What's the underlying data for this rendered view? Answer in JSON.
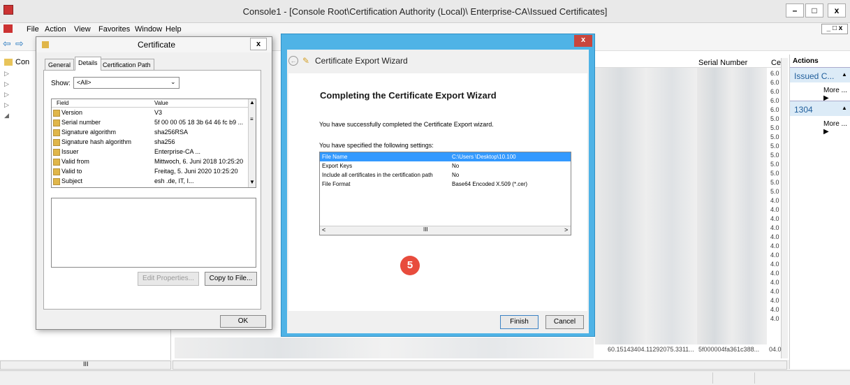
{
  "console": {
    "title": "Console1 - [Console Root\\Certification Authority (Local)\\           Enterprise-CA\\Issued Certificates]",
    "menu": [
      "File",
      "Action",
      "View",
      "Favorites",
      "Window",
      "Help"
    ],
    "tree_root_label": "Con",
    "columns": {
      "serial": "Serial Number",
      "cert": "Cer"
    },
    "bottom_row": {
      "col1": "60.15143404.11292075.3311...",
      "col2": "5f000004fa361c388...",
      "col3": "04.0"
    },
    "cert_col_values": [
      "6.0",
      "6.0",
      "6.0",
      "6.0",
      "6.0",
      "5.0",
      "5.0",
      "5.0",
      "5.0",
      "5.0",
      "5.0",
      "5.0",
      "5.0",
      "5.0",
      "4.0",
      "4.0",
      "4.0",
      "4.0",
      "4.0",
      "4.0",
      "4.0",
      "4.0",
      "4.0",
      "4.0",
      "4.0",
      "4.0",
      "4.0",
      "4.0"
    ]
  },
  "actions": {
    "header": "Actions",
    "section1": "Issued C...",
    "more1": "More ...",
    "section2": "1304",
    "more2": "More ..."
  },
  "certificate": {
    "title": "Certificate",
    "tabs": [
      "General",
      "Details",
      "Certification Path"
    ],
    "show_label": "Show:",
    "show_value": "<All>",
    "col_field": "Field",
    "col_value": "Value",
    "rows": [
      {
        "field": "Version",
        "value": "V3"
      },
      {
        "field": "Serial number",
        "value": "5f 00 00 05 18 3b 64 46 fc b9 ..."
      },
      {
        "field": "Signature algorithm",
        "value": "sha256RSA"
      },
      {
        "field": "Signature hash algorithm",
        "value": "sha256"
      },
      {
        "field": "Issuer",
        "value": "Enterprise-CA ..."
      },
      {
        "field": "Valid from",
        "value": "Mittwoch, 6. Juni 2018 10:25:20"
      },
      {
        "field": "Valid to",
        "value": "Freitag, 5. Juni 2020 10:25:20"
      },
      {
        "field": "Subject",
        "value": "esh .de, IT, I..."
      }
    ],
    "edit_properties": "Edit Properties...",
    "copy_to_file": "Copy to File...",
    "ok": "OK"
  },
  "wizard": {
    "title": "Certificate Export Wizard",
    "heading": "Completing the Certificate Export Wizard",
    "success_text": "You have successfully completed the Certificate Export wizard.",
    "settings_text": "You have specified the following settings:",
    "settings": [
      {
        "name": "File Name",
        "value": "C:\\Users               \\Desktop\\10.100"
      },
      {
        "name": "Export Keys",
        "value": "No"
      },
      {
        "name": "Include all certificates in the certification path",
        "value": "No"
      },
      {
        "name": "File Format",
        "value": "Base64 Encoded X.509 (*.cer)"
      }
    ],
    "step_badge": "5",
    "finish": "Finish",
    "cancel": "Cancel",
    "close": "x"
  },
  "colors": {
    "selection": "#3399ff",
    "wizard_frame": "#4fb3e6",
    "badge": "#e84c3d"
  }
}
